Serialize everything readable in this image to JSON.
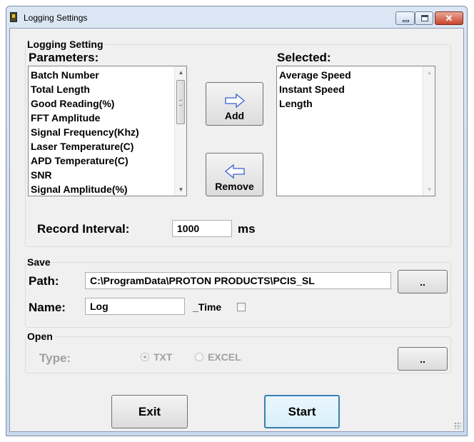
{
  "window": {
    "title": "Logging Settings",
    "controls": {
      "minimize": "minimize",
      "maximize": "maximize",
      "close": "✕"
    }
  },
  "logging": {
    "group_title": "Logging Setting",
    "parameters_label": "Parameters:",
    "parameters": [
      "Batch Number",
      "Total Length",
      "Good Reading(%)",
      "FFT Amplitude",
      "Signal Frequency(Khz)",
      "Laser Temperature(C)",
      "APD Temperature(C)",
      "SNR",
      "Signal Amplitude(%)"
    ],
    "selected_label": "Selected:",
    "selected": [
      "Average Speed",
      "Instant Speed",
      "Length"
    ],
    "add_label": "Add",
    "remove_label": "Remove",
    "record_interval_label": "Record Interval:",
    "record_interval_value": "1000",
    "record_interval_unit": "ms"
  },
  "save": {
    "group_title": "Save",
    "path_label": "Path:",
    "path_value": "C:\\ProgramData\\PROTON PRODUCTS\\PCIS_SL",
    "browse_label": "..",
    "name_label": "Name:",
    "name_value": "Log",
    "time_label": "_Time",
    "time_checked": false
  },
  "open": {
    "group_title": "Open",
    "type_label": "Type:",
    "options": [
      "TXT",
      "EXCEL"
    ],
    "selected_option": "TXT",
    "browse_label": ".."
  },
  "footer": {
    "exit_label": "Exit",
    "start_label": "Start"
  },
  "colors": {
    "focus_border": "#3c7fb1",
    "arrow_icon": "#3a5fcd",
    "disabled_text": "#a0a0a0"
  },
  "icons": {
    "app": "app-icon",
    "add_arrow": "right-arrow-icon",
    "remove_arrow": "left-arrow-icon"
  }
}
